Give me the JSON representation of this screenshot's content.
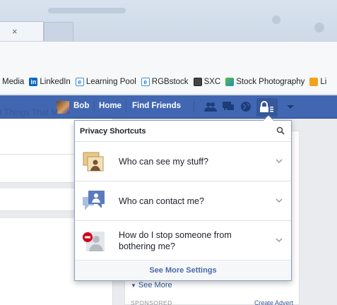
{
  "browser": {
    "tab_close": "×"
  },
  "bookmarks": [
    {
      "label": "Media",
      "icon": "none"
    },
    {
      "label": "LinkedIn",
      "icon": "linkedin-icon"
    },
    {
      "label": "Learning Pool",
      "icon": "ie-page-icon"
    },
    {
      "label": "RGBstock",
      "icon": "ie-page-icon"
    },
    {
      "label": "SXC",
      "icon": "sxc-icon"
    },
    {
      "label": "Stock Photography",
      "icon": "stock-icon"
    },
    {
      "label": "Li",
      "icon": "folder-icon"
    }
  ],
  "topbar": {
    "user_name": "Bob",
    "home": "Home",
    "find_friends": "Find Friends",
    "colors": {
      "bar": "#4267b2",
      "dark": "#29487d"
    }
  },
  "privacy_menu": {
    "title": "Privacy Shortcuts",
    "items": [
      {
        "label": "Who can see my stuff?",
        "icon": "stuff-icon"
      },
      {
        "label": "Who can contact me?",
        "icon": "contact-icon"
      },
      {
        "label": "How do I stop someone from bothering me?",
        "icon": "block-user-icon"
      }
    ],
    "footer": "See More Settings"
  },
  "page": {
    "feed_text": "d Things That M",
    "see_more": "See More",
    "sponsored": "SPONSORED",
    "create_ad": "Create Advert"
  }
}
